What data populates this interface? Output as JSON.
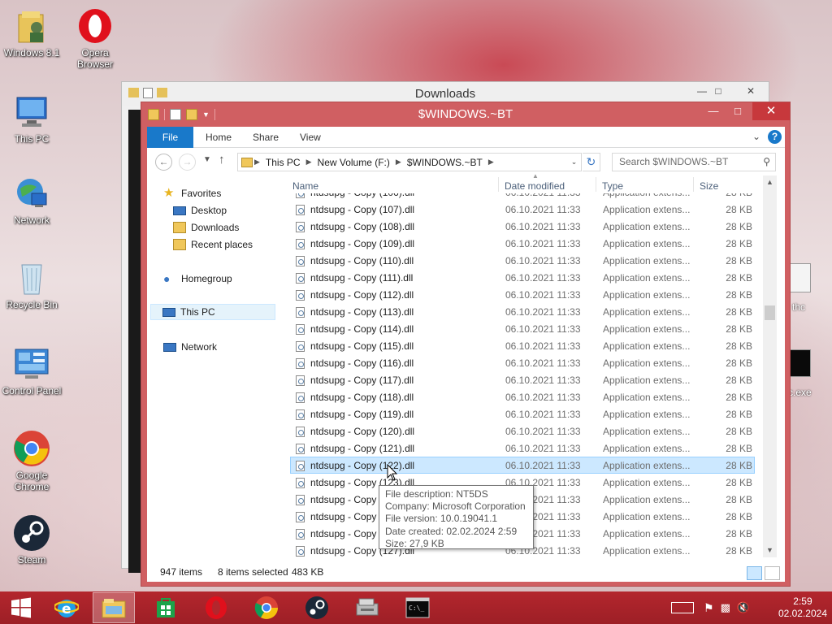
{
  "desktop": {
    "icons": [
      {
        "label": "Windows 8.1"
      },
      {
        "label": "Opera Browser"
      },
      {
        "label": "This PC"
      },
      {
        "label": "Network"
      },
      {
        "label": "Recycle Bin"
      },
      {
        "label": "Control Panel"
      },
      {
        "label": "Google Chrome"
      },
      {
        "label": "Steam"
      }
    ],
    "peek_right_1": "thc",
    "peek_right_2": "c.exe"
  },
  "back_window": {
    "title": "Downloads"
  },
  "window": {
    "title": "$WINDOWS.~BT",
    "accent_color": "#d05f62",
    "ribbon_tabs": [
      {
        "label": "File"
      },
      {
        "label": "Home"
      },
      {
        "label": "Share"
      },
      {
        "label": "View"
      }
    ],
    "address": {
      "crumbs": [
        "This PC",
        "New Volume (F:)",
        "$WINDOWS.~BT"
      ]
    },
    "search": {
      "placeholder": "Search $WINDOWS.~BT"
    },
    "nav_pane": {
      "favorites": "Favorites",
      "desktop": "Desktop",
      "downloads": "Downloads",
      "recent": "Recent places",
      "homegroup": "Homegroup",
      "thispc": "This PC",
      "network": "Network"
    },
    "columns": {
      "name": "Name",
      "date": "Date modified",
      "type": "Type",
      "size": "Size"
    },
    "files": [
      {
        "name": "ntdsupg - Copy (106).dll",
        "date": "06.10.2021 11:33",
        "type": "Application extens...",
        "size": "28 KB"
      },
      {
        "name": "ntdsupg - Copy (107).dll",
        "date": "06.10.2021 11:33",
        "type": "Application extens...",
        "size": "28 KB"
      },
      {
        "name": "ntdsupg - Copy (108).dll",
        "date": "06.10.2021 11:33",
        "type": "Application extens...",
        "size": "28 KB"
      },
      {
        "name": "ntdsupg - Copy (109).dll",
        "date": "06.10.2021 11:33",
        "type": "Application extens...",
        "size": "28 KB"
      },
      {
        "name": "ntdsupg - Copy (110).dll",
        "date": "06.10.2021 11:33",
        "type": "Application extens...",
        "size": "28 KB"
      },
      {
        "name": "ntdsupg - Copy (111).dll",
        "date": "06.10.2021 11:33",
        "type": "Application extens...",
        "size": "28 KB"
      },
      {
        "name": "ntdsupg - Copy (112).dll",
        "date": "06.10.2021 11:33",
        "type": "Application extens...",
        "size": "28 KB"
      },
      {
        "name": "ntdsupg - Copy (113).dll",
        "date": "06.10.2021 11:33",
        "type": "Application extens...",
        "size": "28 KB"
      },
      {
        "name": "ntdsupg - Copy (114).dll",
        "date": "06.10.2021 11:33",
        "type": "Application extens...",
        "size": "28 KB"
      },
      {
        "name": "ntdsupg - Copy (115).dll",
        "date": "06.10.2021 11:33",
        "type": "Application extens...",
        "size": "28 KB"
      },
      {
        "name": "ntdsupg - Copy (116).dll",
        "date": "06.10.2021 11:33",
        "type": "Application extens...",
        "size": "28 KB"
      },
      {
        "name": "ntdsupg - Copy (117).dll",
        "date": "06.10.2021 11:33",
        "type": "Application extens...",
        "size": "28 KB"
      },
      {
        "name": "ntdsupg - Copy (118).dll",
        "date": "06.10.2021 11:33",
        "type": "Application extens...",
        "size": "28 KB"
      },
      {
        "name": "ntdsupg - Copy (119).dll",
        "date": "06.10.2021 11:33",
        "type": "Application extens...",
        "size": "28 KB"
      },
      {
        "name": "ntdsupg - Copy (120).dll",
        "date": "06.10.2021 11:33",
        "type": "Application extens...",
        "size": "28 KB"
      },
      {
        "name": "ntdsupg - Copy (121).dll",
        "date": "06.10.2021 11:33",
        "type": "Application extens...",
        "size": "28 KB"
      },
      {
        "name": "ntdsupg - Copy (122).dll",
        "date": "06.10.2021 11:33",
        "type": "Application extens...",
        "size": "28 KB"
      },
      {
        "name": "ntdsupg - Copy (123).dll",
        "date": "06.10.2021 11:33",
        "type": "Application extens...",
        "size": "28 KB"
      },
      {
        "name": "ntdsupg - Copy (124).dll",
        "date": "06.10.2021 11:33",
        "type": "Application extens...",
        "size": "28 KB"
      },
      {
        "name": "ntdsupg - Copy (125).dll",
        "date": "06.10.2021 11:33",
        "type": "Application extens...",
        "size": "28 KB"
      },
      {
        "name": "ntdsupg - Copy (126).dll",
        "date": "06.10.2021 11:33",
        "type": "Application extens...",
        "size": "28 KB"
      },
      {
        "name": "ntdsupg - Copy (127).dll",
        "date": "06.10.2021 11:33",
        "type": "Application extens...",
        "size": "28 KB"
      }
    ],
    "status": {
      "items": "947 items",
      "selected": "8 items selected",
      "selected_size": "483 KB"
    },
    "tooltip": {
      "l1": "File description: NT5DS",
      "l2": "Company: Microsoft Corporation",
      "l3": "File version: 10.0.19041.1",
      "l4": "Date created: 02.02.2024 2:59",
      "l5": "Size: 27,9 KB"
    }
  },
  "taskbar": {
    "color": "#a8232a",
    "clock_time": "2:59",
    "clock_date": "02.02.2024"
  }
}
